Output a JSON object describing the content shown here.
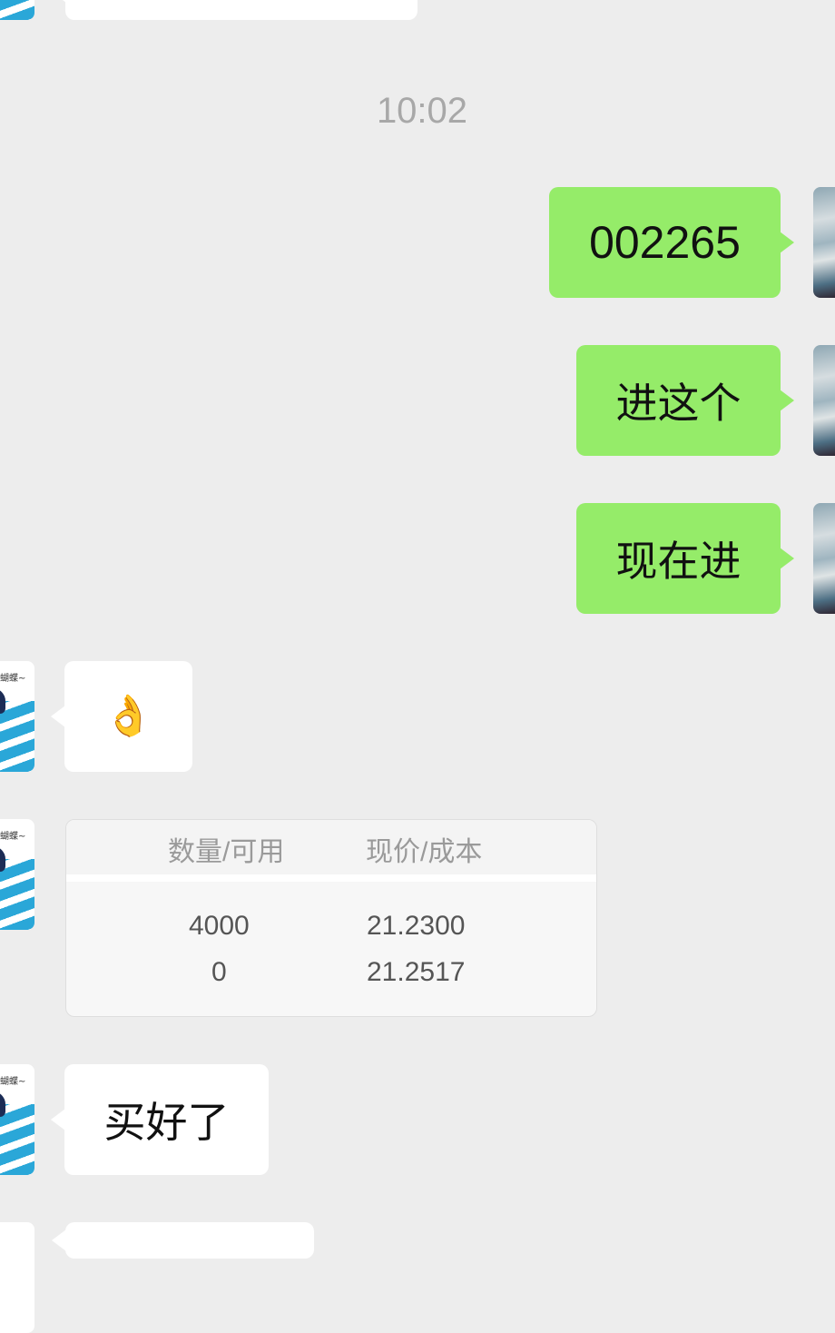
{
  "chat": {
    "timestamp": "10:02",
    "messages": [
      {
        "sender": "self",
        "text": "002265"
      },
      {
        "sender": "self",
        "text": "进这个"
      },
      {
        "sender": "self",
        "text": "现在进"
      },
      {
        "sender": "other",
        "emoji": "👌"
      },
      {
        "sender": "other",
        "type": "position-card"
      },
      {
        "sender": "other",
        "text": "买好了"
      }
    ],
    "contact_avatar_caption": "蝴蝶~"
  },
  "position_card": {
    "headers": {
      "quantity_available": "数量/可用",
      "price_cost": "现价/成本"
    },
    "rows": [
      {
        "quantity": "4000",
        "price": "21.2300"
      },
      {
        "quantity": "0",
        "price": "21.2517"
      }
    ]
  },
  "colors": {
    "background": "#ededed",
    "self_bubble": "#95ec69",
    "other_bubble": "#ffffff",
    "timestamp_text": "#a8a8a8"
  },
  "icons": {
    "self_avatar": "sky-clouds-avatar-icon",
    "other_avatar": "cartoon-avatar-icon"
  }
}
